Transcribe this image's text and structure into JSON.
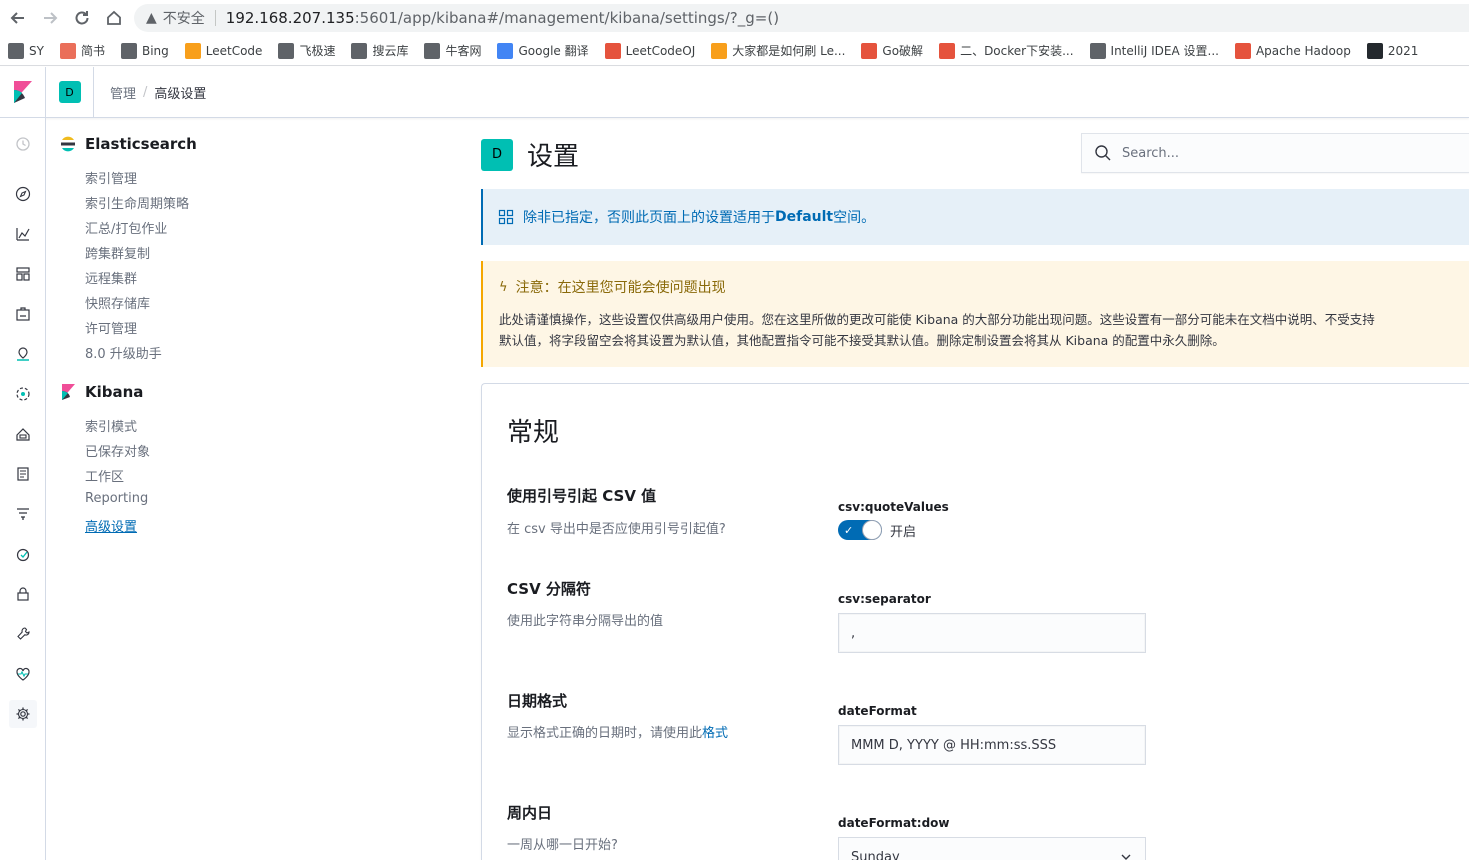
{
  "browser": {
    "insecure_label": "不安全",
    "url_host": "192.168.207.135",
    "url_path": ":5601/app/kibana#/management/kibana/settings/?_g=()",
    "bookmarks": [
      {
        "label": "SY",
        "color": "#5f6368"
      },
      {
        "label": "简书",
        "color": "#ea6f5a"
      },
      {
        "label": "Bing",
        "color": "#5f6368"
      },
      {
        "label": "LeetCode",
        "color": "#f89f1b"
      },
      {
        "label": "飞极速",
        "color": "#5f6368"
      },
      {
        "label": "搜云库",
        "color": "#5f6368"
      },
      {
        "label": "牛客网",
        "color": "#5f6368"
      },
      {
        "label": "Google 翻译",
        "color": "#4285f4"
      },
      {
        "label": "LeetCodeOJ",
        "color": "#e5533d"
      },
      {
        "label": "大家都是如何刷 Le...",
        "color": "#f89f1b"
      },
      {
        "label": "Go破解",
        "color": "#e5533d"
      },
      {
        "label": "二、Docker下安装...",
        "color": "#e5533d"
      },
      {
        "label": "IntelliJ IDEA 设置...",
        "color": "#5f6368"
      },
      {
        "label": "Apache Hadoop",
        "color": "#e5533d"
      },
      {
        "label": "2021",
        "color": "#24292e"
      }
    ]
  },
  "header": {
    "space_initial": "D",
    "breadcrumb_root": "管理",
    "breadcrumb_current": "高级设置"
  },
  "sidebar": {
    "elasticsearch": {
      "title": "Elasticsearch",
      "items": [
        "索引管理",
        "索引生命周期策略",
        "汇总/打包作业",
        "跨集群复制",
        "远程集群",
        "快照存储库",
        "许可管理",
        "8.0 升级助手"
      ]
    },
    "kibana": {
      "title": "Kibana",
      "items": [
        "索引模式",
        "已保存对象",
        "工作区",
        "Reporting",
        "高级设置"
      ]
    }
  },
  "page": {
    "avatar_initial": "D",
    "title": "设置",
    "search_placeholder": "Search..."
  },
  "info_callout": {
    "prefix": "除非已指定，否则此页面上的设置适用于 ",
    "space_name": "Default",
    "suffix": " 空间。"
  },
  "warning_callout": {
    "title": "注意：在这里您可能会使问题出现",
    "line1": "此处请谨慎操作，这些设置仅供高级用户使用。您在这里所做的更改可能使 Kibana 的大部分功能出现问题。这些设置有一部分可能未在文档中说明、不受支持",
    "line2": "默认值，将字段留空会将其设置为默认值，其他配置指令可能不接受其默认值。删除定制设置会将其从 Kibana 的配置中永久删除。"
  },
  "general": {
    "title": "常规",
    "fields": [
      {
        "title": "使用引号引起 CSV 值",
        "desc": "在 csv 导出中是否应使用引号引起值?",
        "key": "csv:quoteValues",
        "toggle_label": "开启",
        "enabled": true
      },
      {
        "title": "CSV 分隔符",
        "desc": "使用此字符串分隔导出的值",
        "key": "csv:separator",
        "value": ","
      },
      {
        "title": "日期格式",
        "desc": "显示格式正确的日期时，请使用此",
        "desc_link": "格式",
        "key": "dateFormat",
        "value": "MMM D, YYYY @ HH:mm:ss.SSS"
      },
      {
        "title": "周内日",
        "desc": "一周从哪一日开始?",
        "key": "dateFormat:dow",
        "value": "Sunday"
      }
    ]
  },
  "colors": {
    "accent": "#006bb4",
    "space": "#00bfb3",
    "warning": "#f5a700"
  }
}
